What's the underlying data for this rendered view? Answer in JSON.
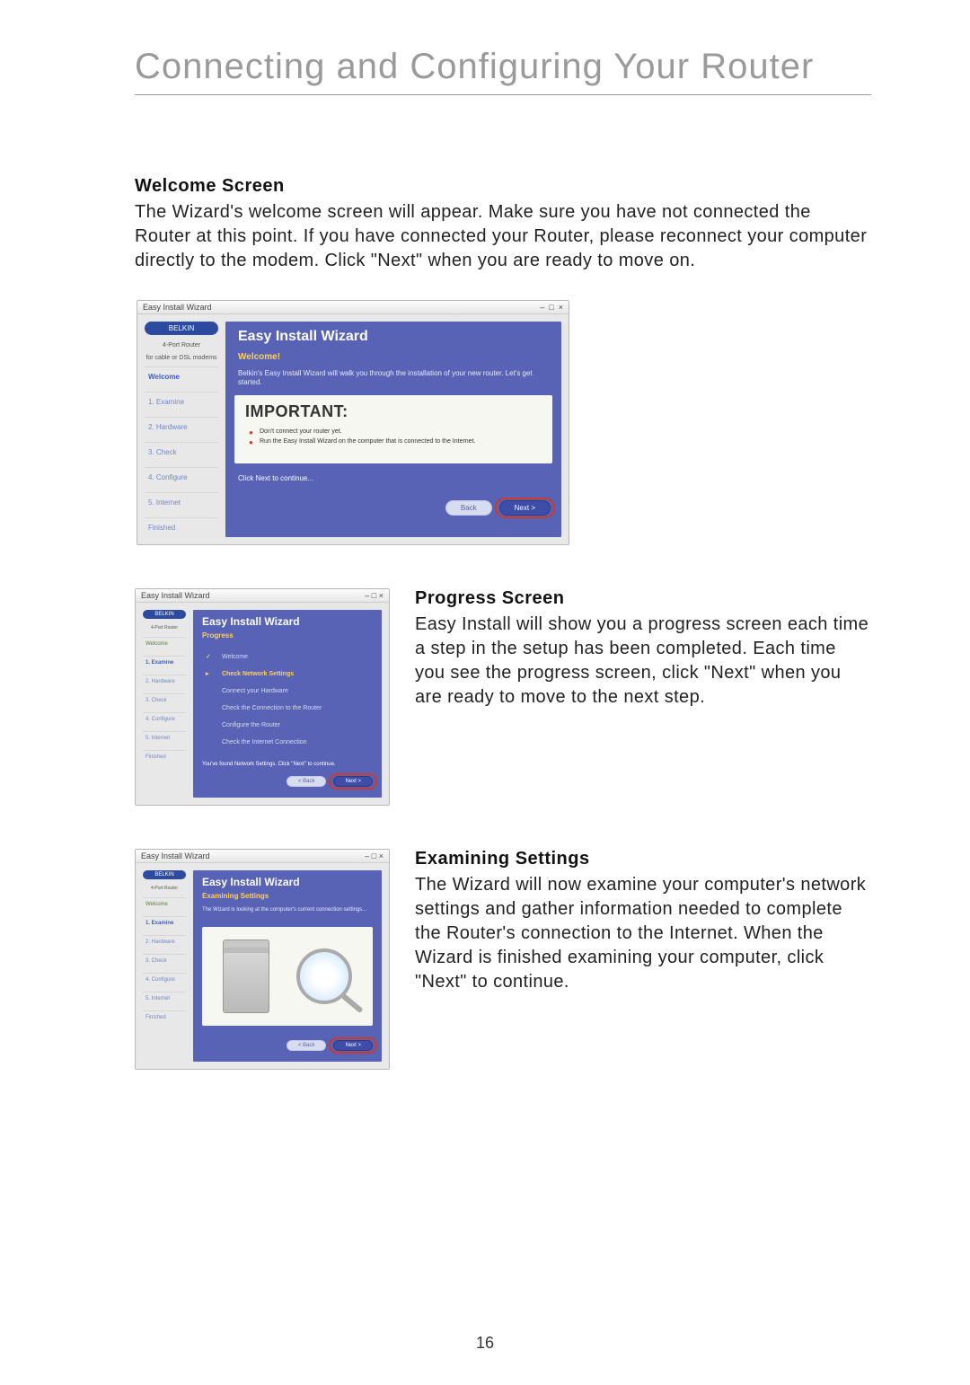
{
  "page_title": "Connecting and Configuring Your Router",
  "page_number": "16",
  "welcome": {
    "heading": "Welcome Screen",
    "body": "The Wizard's welcome screen will appear. Make sure you have not connected the Router at this point. If you have connected your Router, please reconnect your computer directly to the modem. Click \"Next\" when you are ready to move on."
  },
  "progress": {
    "heading": "Progress Screen",
    "body": "Easy Install will show you a progress screen each time a step in the setup has been completed. Each time you see the progress screen, click \"Next\" when you are ready to move to the next step."
  },
  "examining": {
    "heading": "Examining Settings",
    "body": "The Wizard will now examine your computer's network settings and gather information needed to complete the Router's connection to the Internet. When the Wizard is finished examining your computer, click \"Next\" to continue."
  },
  "wizard_common": {
    "window_title": "Easy Install Wizard",
    "brand": "BELKIN",
    "product": "4-Port Router",
    "product_sub": "for cable or DSL modems"
  },
  "wizard_welcome": {
    "banner": "Easy Install Wizard",
    "subtitle": "Welcome!",
    "description": "Belkin's Easy Install Wizard will walk you through the installation of your new router. Let's get started.",
    "important_title": "IMPORTANT:",
    "bullet1": "Don't connect your router yet.",
    "bullet2": "Run the Easy Install Wizard on the computer that is connected to the Internet.",
    "continue_text": "Click Next to continue...",
    "back": "Back",
    "next": "Next >",
    "steps": {
      "welcome": "Welcome",
      "examine": "1. Examine",
      "hardware": "2. Hardware",
      "check": "3. Check",
      "configure": "4. Configure",
      "internet": "5. Internet",
      "finished": "Finished"
    }
  },
  "wizard_progress": {
    "banner": "Easy Install Wizard",
    "subtitle": "Progress",
    "steps_list": {
      "s1": "Welcome",
      "s2": "Check Network Settings",
      "s3": "Connect your Hardware",
      "s4": "Check the Connection to the Router",
      "s5": "Configure the Router",
      "s6": "Check the Internet Connection"
    },
    "continue_text": "You've found Network Settings. Click \"Next\" to continue.",
    "back": "< Back",
    "next": "Next >"
  },
  "wizard_examine": {
    "banner": "Easy Install Wizard",
    "subtitle": "Examining Settings",
    "description": "The Wizard is looking at the computer's current connection settings...",
    "back": "< Back",
    "next": "Next >"
  }
}
